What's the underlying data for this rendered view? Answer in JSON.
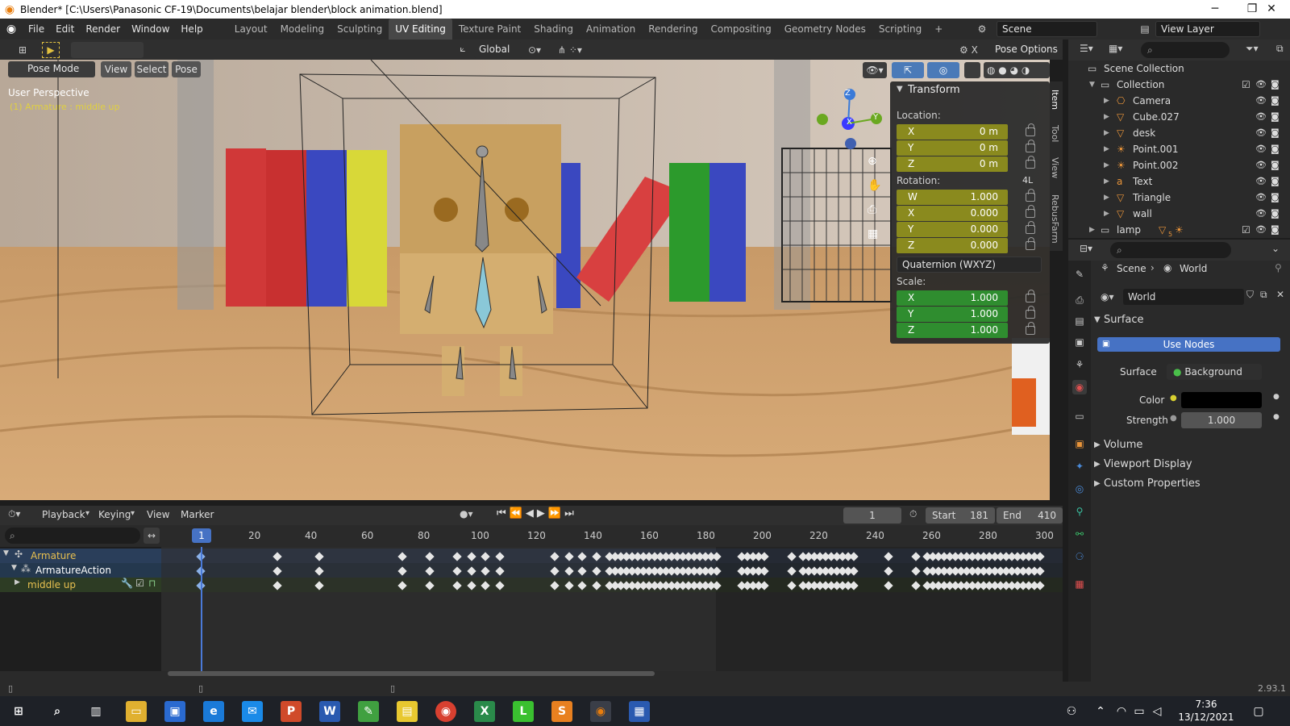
{
  "window": {
    "title": "Blender* [C:\\Users\\Panasonic CF-19\\Documents\\belajar blender\\block animation.blend]",
    "minimize": "─",
    "maximize": "❐",
    "close": "✕"
  },
  "menu": [
    "File",
    "Edit",
    "Render",
    "Window",
    "Help"
  ],
  "workspaces": [
    "Layout",
    "Modeling",
    "Sculpting",
    "UV Editing",
    "Texture Paint",
    "Shading",
    "Animation",
    "Rendering",
    "Compositing",
    "Geometry Nodes",
    "Scripting"
  ],
  "workspace_add": "+",
  "scene_name": "Scene",
  "view_layer_name": "View Layer",
  "viewport_header": {
    "transform_orientation": "Global",
    "pose_options": "Pose Options",
    "mode": "Pose Mode",
    "view": "View",
    "select": "Select",
    "pose": "Pose"
  },
  "viewport": {
    "perspective": "User Perspective",
    "active": "(1) Armature : middle up",
    "gizmo_axes": [
      "Z",
      "X",
      "Y"
    ]
  },
  "sidebar_tabs": [
    "Item",
    "Tool",
    "View",
    "RebusFarm"
  ],
  "transform": {
    "title": "Transform",
    "location_label": "Location:",
    "location": [
      {
        "axis": "X",
        "value": "0 m"
      },
      {
        "axis": "Y",
        "value": "0 m"
      },
      {
        "axis": "Z",
        "value": "0 m"
      }
    ],
    "rotation_label": "Rotation:",
    "rotation_mode_short": "4L",
    "rotation": [
      {
        "axis": "W",
        "value": "1.000"
      },
      {
        "axis": "X",
        "value": "0.000"
      },
      {
        "axis": "Y",
        "value": "0.000"
      },
      {
        "axis": "Z",
        "value": "0.000"
      }
    ],
    "rotation_mode": "Quaternion (WXYZ)",
    "scale_label": "Scale:",
    "scale": [
      {
        "axis": "X",
        "value": "1.000"
      },
      {
        "axis": "Y",
        "value": "1.000"
      },
      {
        "axis": "Z",
        "value": "1.000"
      }
    ]
  },
  "outliner": {
    "scene_collection": "Scene Collection",
    "collection": "Collection",
    "items": [
      "Camera",
      "Cube.027",
      "desk",
      "Point.001",
      "Point.002",
      "Text",
      "Triangle",
      "wall"
    ],
    "extra": "lamp",
    "lamp_count": "5"
  },
  "properties": {
    "breadcrumb_scene": "Scene",
    "breadcrumb_world": "World",
    "world_name": "World",
    "surface_header": "Surface",
    "use_nodes": "Use Nodes",
    "surface_label": "Surface",
    "surface_value": "Background",
    "color_label": "Color",
    "strength_label": "Strength",
    "strength_value": "1.000",
    "volume": "Volume",
    "viewport_display": "Viewport Display",
    "custom_properties": "Custom Properties"
  },
  "timeline": {
    "playback": "Playback",
    "keying": "Keying",
    "view": "View",
    "marker": "Marker",
    "current_frame": "1",
    "start_label": "Start",
    "start": "181",
    "end_label": "End",
    "end": "410",
    "ruler": [
      "1",
      "20",
      "40",
      "60",
      "80",
      "100",
      "120",
      "140",
      "160",
      "180",
      "200",
      "220",
      "240",
      "260",
      "280",
      "300"
    ],
    "channels": [
      "Armature",
      "ArmatureAction",
      "middle up"
    ]
  },
  "status": {
    "version": "2.93.1"
  },
  "taskbar": {
    "time": "7:36",
    "date": "13/12/2021"
  }
}
